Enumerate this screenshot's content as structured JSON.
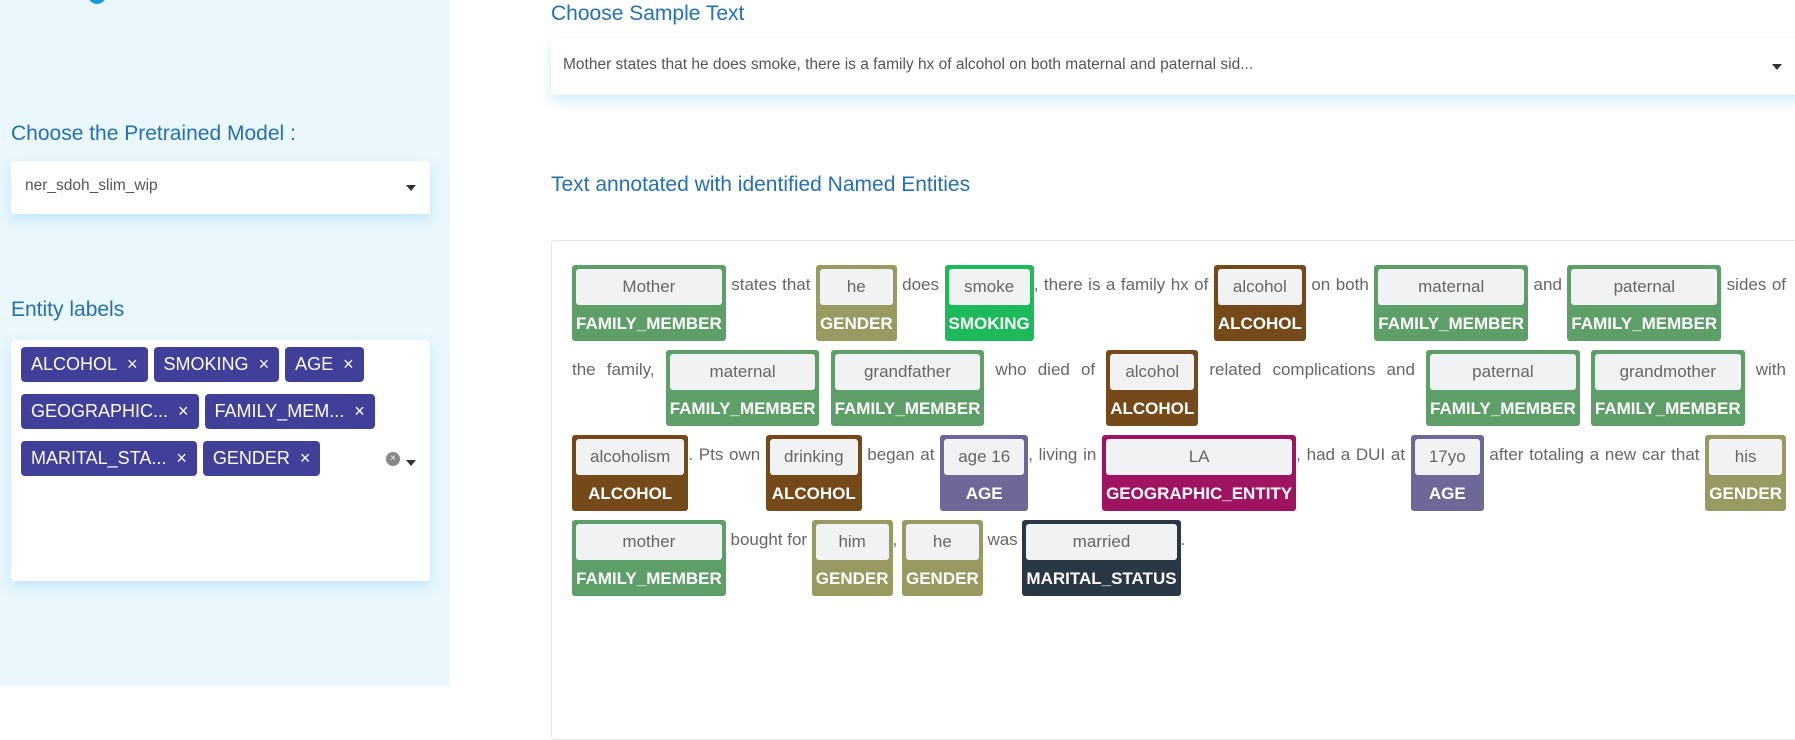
{
  "sidebar": {
    "model_heading": "Choose the Pretrained Model :",
    "model_value": "ner_sdoh_slim_wip",
    "labels_heading": "Entity labels",
    "tags": [
      "ALCOHOL",
      "SMOKING",
      "AGE",
      "GEOGRAPHIC...",
      "FAMILY_MEM...",
      "MARITAL_STA...",
      "GENDER"
    ],
    "tag_remove": "×",
    "clear_icon": "×"
  },
  "main": {
    "sample_heading": "Choose Sample Text",
    "sample_value": "Mother states that he does smoke, there is a family hx of alcohol on both maternal and paternal sid...",
    "annotated_heading": "Text annotated with identified Named Entities"
  },
  "colors": {
    "FAMILY_MEMBER": "#5e9e68",
    "GENDER": "#999962",
    "SMOKING": "#1dba5b",
    "ALCOHOL": "#744a1a",
    "AGE": "#6e6899",
    "GEOGRAPHIC_ENTITY": "#9e1461",
    "MARITAL_STATUS": "#2a3744",
    "tag": "#40409a",
    "heading": "#2470b3"
  },
  "segments": [
    {
      "c": "Mother",
      "l": "FAMILY_MEMBER"
    },
    {
      "t": " states that "
    },
    {
      "c": "he",
      "l": "GENDER"
    },
    {
      "t": " does "
    },
    {
      "c": "smoke",
      "l": "SMOKING"
    },
    {
      "t": ", there is a family hx of "
    },
    {
      "c": "alcohol",
      "l": "ALCOHOL"
    },
    {
      "t": " on both "
    },
    {
      "c": "maternal",
      "l": "FAMILY_MEMBER"
    },
    {
      "t": " and "
    },
    {
      "c": "paternal",
      "l": "FAMILY_MEMBER"
    },
    {
      "t": " sides of the family, "
    },
    {
      "c": "maternal",
      "l": "FAMILY_MEMBER"
    },
    {
      "t": " "
    },
    {
      "c": "grandfather",
      "l": "FAMILY_MEMBER"
    },
    {
      "t": " who died of "
    },
    {
      "c": "alcohol",
      "l": "ALCOHOL"
    },
    {
      "t": " related complications and "
    },
    {
      "c": "paternal",
      "l": "FAMILY_MEMBER"
    },
    {
      "t": " "
    },
    {
      "c": "grandmother",
      "l": "FAMILY_MEMBER"
    },
    {
      "t": " with "
    },
    {
      "c": "alcoholism",
      "l": "ALCOHOL"
    },
    {
      "t": ". Pts own "
    },
    {
      "c": "drinking",
      "l": "ALCOHOL"
    },
    {
      "t": " began at "
    },
    {
      "c": "age 16",
      "l": "AGE"
    },
    {
      "t": ", living in "
    },
    {
      "c": "LA",
      "l": "GEOGRAPHIC_ENTITY"
    },
    {
      "t": ", had a DUI at "
    },
    {
      "c": "17yo",
      "l": "AGE"
    },
    {
      "t": " after totaling a new car that "
    },
    {
      "c": "his",
      "l": "GENDER"
    },
    {
      "t": " "
    },
    {
      "c": "mother",
      "l": "FAMILY_MEMBER"
    },
    {
      "t": " bought for "
    },
    {
      "c": "him",
      "l": "GENDER"
    },
    {
      "t": ", "
    },
    {
      "c": "he",
      "l": "GENDER"
    },
    {
      "t": " was "
    },
    {
      "c": "married",
      "l": "MARITAL_STATUS"
    },
    {
      "t": "."
    }
  ]
}
